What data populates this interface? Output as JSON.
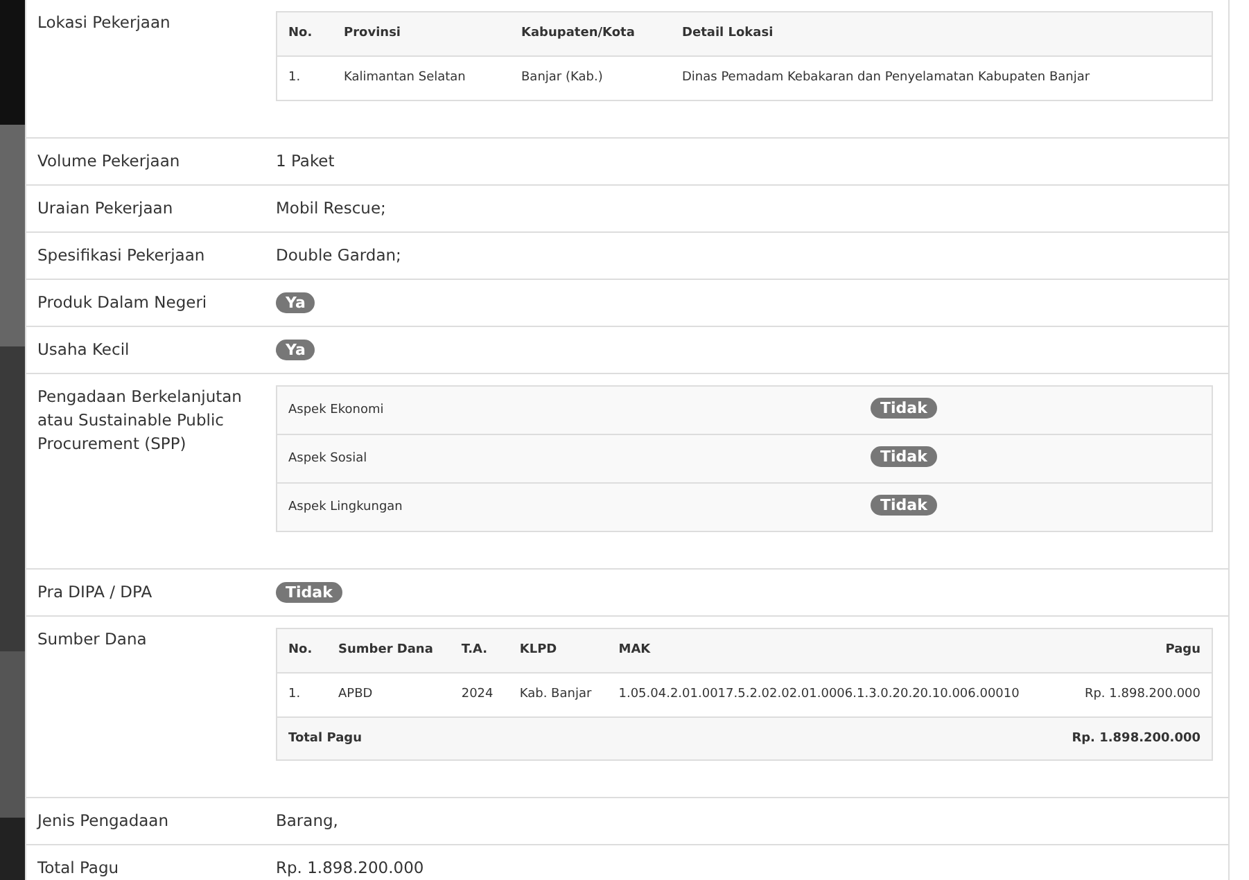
{
  "fields": [
    {
      "label": "Lokasi Pekerjaan",
      "kind": "location_table",
      "table": {
        "columns": [
          "No.",
          "Provinsi",
          "Kabupaten/Kota",
          "Detail Lokasi"
        ],
        "rows": [
          [
            "1.",
            "Kalimantan Selatan",
            "Banjar (Kab.)",
            "Dinas Pemadam Kebakaran dan Penyelamatan Kabupaten Banjar"
          ]
        ]
      }
    },
    {
      "label": "Volume Pekerjaan",
      "kind": "text",
      "value": "1 Paket"
    },
    {
      "label": "Uraian Pekerjaan",
      "kind": "text",
      "value": "Mobil Rescue;"
    },
    {
      "label": "Spesifikasi Pekerjaan",
      "kind": "text",
      "value": "Double Gardan;"
    },
    {
      "label": "Produk Dalam Negeri",
      "kind": "badge",
      "value": "Ya"
    },
    {
      "label": "Usaha Kecil",
      "kind": "badge",
      "value": "Ya"
    },
    {
      "label": "Pengadaan Berkelanjutan atau Sustainable Public Procurement (SPP)",
      "kind": "aspect_table",
      "aspects": [
        {
          "name": "Aspek Ekonomi",
          "value": "Tidak"
        },
        {
          "name": "Aspek Sosial",
          "value": "Tidak"
        },
        {
          "name": "Aspek Lingkungan",
          "value": "Tidak"
        }
      ]
    },
    {
      "label": "Pra DIPA / DPA",
      "kind": "badge",
      "value": "Tidak"
    },
    {
      "label": "Sumber Dana",
      "kind": "funding_table",
      "table": {
        "columns": [
          "No.",
          "Sumber Dana",
          "T.A.",
          "KLPD",
          "MAK",
          "Pagu"
        ],
        "rows": [
          [
            "1.",
            "APBD",
            "2024",
            "Kab. Banjar",
            "1.05.04.2.01.0017.5.2.02.02.01.0006.1.3.0.20.20.10.006.00010",
            "Rp. 1.898.200.000"
          ]
        ],
        "total_label": "Total Pagu",
        "total_value": "Rp. 1.898.200.000"
      }
    },
    {
      "label": "Jenis Pengadaan",
      "kind": "text",
      "value": "Barang,"
    },
    {
      "label": "Total Pagu",
      "kind": "text",
      "value": "Rp. 1.898.200.000"
    }
  ]
}
